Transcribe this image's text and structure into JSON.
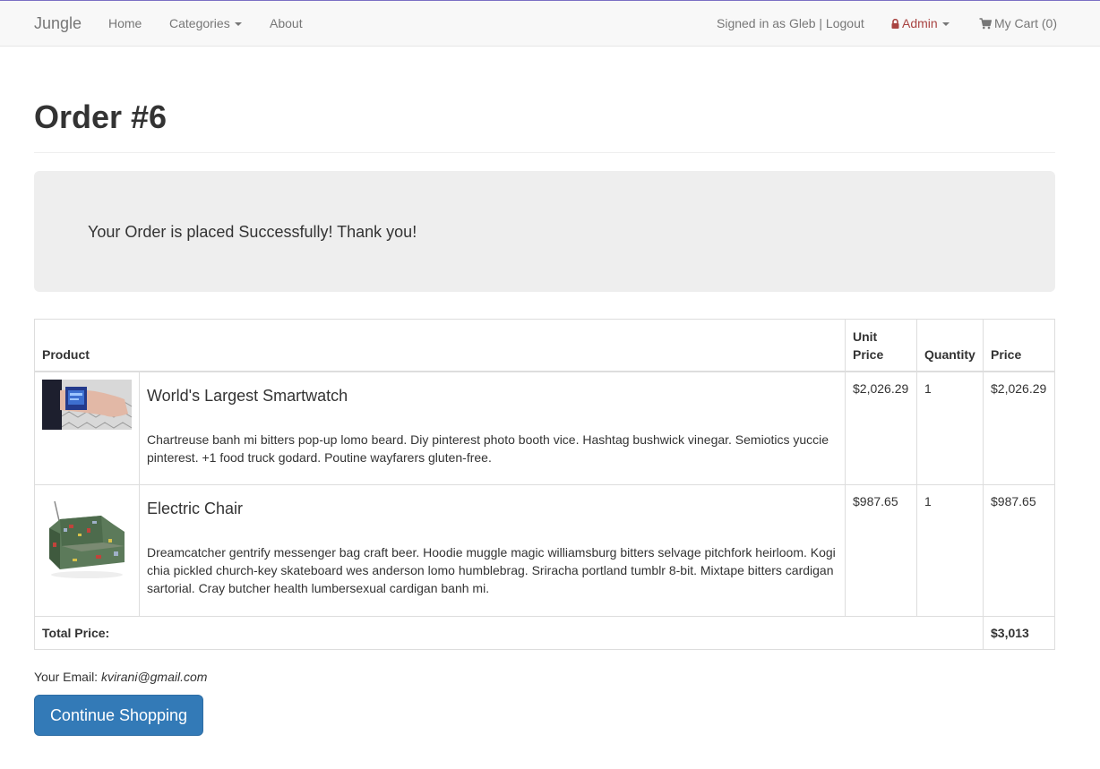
{
  "navbar": {
    "brand": "Jungle",
    "home": "Home",
    "categories": "Categories",
    "about": "About",
    "signed_in": "Signed in as Gleb | Logout",
    "admin": "Admin",
    "cart": "My Cart (0)"
  },
  "page": {
    "title": "Order #6",
    "success_message": "Your Order is placed Successfully! Thank you!"
  },
  "table": {
    "headers": {
      "product": "Product",
      "unit_price": "Unit Price",
      "quantity": "Quantity",
      "price": "Price"
    },
    "rows": [
      {
        "name": "World's Largest Smartwatch",
        "description": "Chartreuse banh mi bitters pop-up lomo beard. Diy pinterest photo booth vice. Hashtag bushwick vinegar. Semiotics yuccie pinterest. +1 food truck godard. Poutine wayfarers gluten-free.",
        "unit_price": "$2,026.29",
        "quantity": "1",
        "price": "$2,026.29"
      },
      {
        "name": "Electric Chair",
        "description": "Dreamcatcher gentrify messenger bag craft beer. Hoodie muggle magic williamsburg bitters selvage pitchfork heirloom. Kogi chia pickled church-key skateboard wes anderson lomo humblebrag. Sriracha portland tumblr 8-bit. Mixtape bitters cardigan sartorial. Cray butcher health lumbersexual cardigan banh mi.",
        "unit_price": "$987.65",
        "quantity": "1",
        "price": "$987.65"
      }
    ],
    "total_label": "Total Price:",
    "total_value": "$3,013"
  },
  "footer": {
    "email_label": "Your Email:",
    "email_value": "kvirani@gmail.com",
    "continue_button": "Continue Shopping"
  },
  "colors": {
    "primary_button": "#337ab7",
    "admin_text": "#a94442",
    "navbar_bg": "#f8f8f8",
    "jumbotron_bg": "#eeeeee"
  },
  "icons": [
    "lock-icon",
    "cart-icon",
    "caret-down-icon"
  ]
}
